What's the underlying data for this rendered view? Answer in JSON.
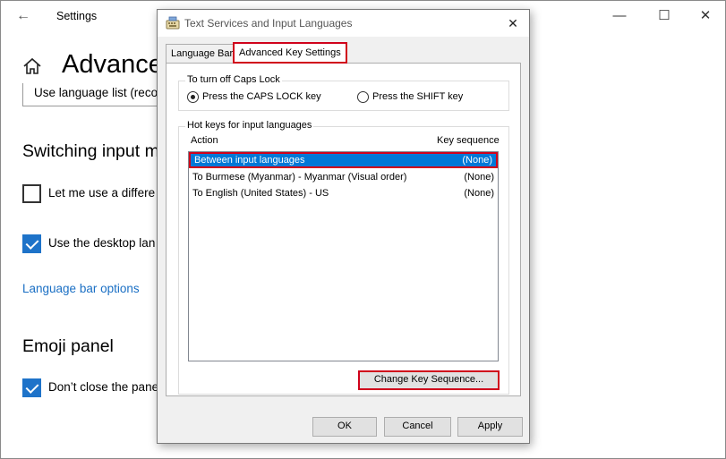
{
  "settings": {
    "title": "Settings",
    "page_title": "Advanced",
    "dropdown_value": "Use language list (reco",
    "switching_title": "Switching input m",
    "checkbox_1": {
      "label": "Let me use a differe",
      "checked": false
    },
    "checkbox_2": {
      "label": "Use the desktop lan",
      "checked": true
    },
    "link": "Language bar options",
    "emoji_title": "Emoji panel",
    "checkbox_3": {
      "label": "Don’t close the pane",
      "checked": true
    },
    "controls": {
      "back": "←",
      "minimize": "—",
      "maximize": "☐",
      "close": "✕"
    }
  },
  "dialog": {
    "title": "Text Services and Input Languages",
    "close": "✕",
    "tabs": [
      {
        "label": "Language Bar",
        "active": false
      },
      {
        "label": "Advanced Key Settings",
        "active": true
      }
    ],
    "caps_lock": {
      "caption": "To turn off Caps Lock",
      "options": [
        {
          "label": "Press the CAPS LOCK key",
          "selected": true
        },
        {
          "label": "Press the SHIFT key",
          "selected": false
        }
      ]
    },
    "hotkeys": {
      "caption": "Hot keys for input languages",
      "col_action": "Action",
      "col_sequence": "Key sequence",
      "rows": [
        {
          "action": "Between input languages",
          "sequence": "(None)",
          "selected": true
        },
        {
          "action": "To Burmese (Myanmar) - Myanmar (Visual order)",
          "sequence": "(None)",
          "selected": false
        },
        {
          "action": "To English (United States) - US",
          "sequence": "(None)",
          "selected": false
        }
      ],
      "change_button": "Change Key Sequence..."
    },
    "buttons": {
      "ok": "OK",
      "cancel": "Cancel",
      "apply": "Apply"
    }
  },
  "colors": {
    "highlight_red": "#d0021b",
    "selection_blue": "#0078d7",
    "link_blue": "#1a6fc4",
    "checkbox_blue": "#1e73c9"
  }
}
